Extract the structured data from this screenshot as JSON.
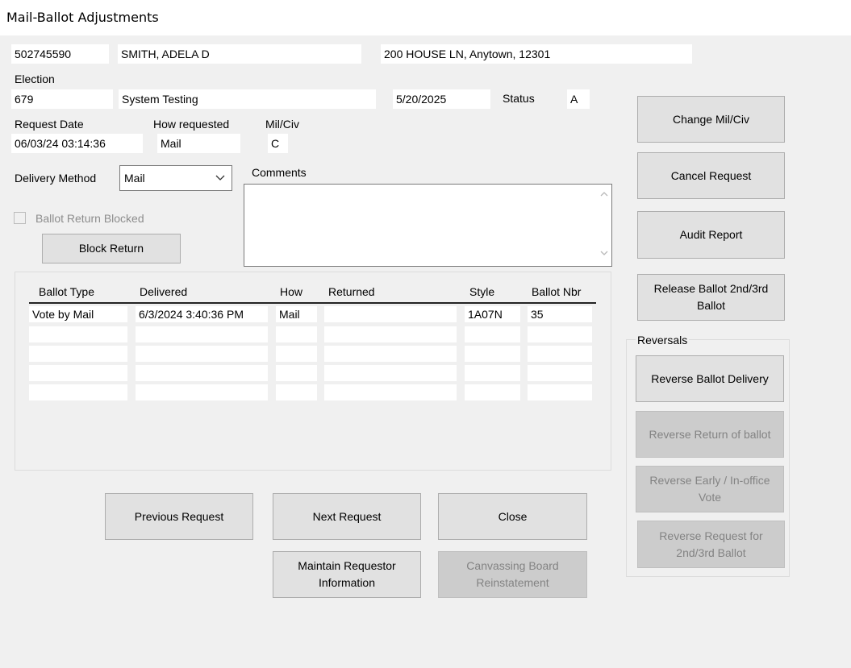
{
  "window": {
    "title": "Mail-Ballot Adjustments"
  },
  "voter": {
    "id": "502745590",
    "name": "SMITH, ADELA D",
    "address": "200 HOUSE LN, Anytown, 12301"
  },
  "election": {
    "label": "Election",
    "number": "679",
    "name": "System Testing",
    "date": "5/20/2025",
    "status_label": "Status",
    "status": "A"
  },
  "request": {
    "date_label": "Request Date",
    "date": "06/03/24 03:14:36",
    "how_label": "How requested",
    "how": "Mail",
    "milciv_label": "Mil/Civ",
    "milciv": "C"
  },
  "delivery": {
    "label": "Delivery Method",
    "selected": "Mail"
  },
  "comments": {
    "label": "Comments",
    "value": ""
  },
  "blocked": {
    "checkbox_label": "Ballot Return Blocked",
    "checked": false,
    "block_button": "Block Return"
  },
  "ballots": {
    "headers": [
      "Ballot Type",
      "Delivered",
      "How",
      "Returned",
      "Style",
      "Ballot Nbr"
    ],
    "rows": [
      [
        "Vote by Mail",
        "6/3/2024 3:40:36 PM",
        "Mail",
        "",
        "1A07N",
        "35"
      ],
      [
        "",
        "",
        "",
        "",
        "",
        ""
      ],
      [
        "",
        "",
        "",
        "",
        "",
        ""
      ],
      [
        "",
        "",
        "",
        "",
        "",
        ""
      ],
      [
        "",
        "",
        "",
        "",
        "",
        ""
      ]
    ]
  },
  "actions": {
    "change_milciv": "Change Mil/Civ",
    "cancel_request": "Cancel Request",
    "audit_report": "Audit Report",
    "release_ballot": "Release Ballot 2nd/3rd Ballot",
    "reversals_label": "Reversals",
    "reverse_delivery": "Reverse Ballot Delivery",
    "reverse_return": "Reverse Return of ballot",
    "reverse_early": "Reverse Early / In-office Vote",
    "reverse_request": "Reverse Request for 2nd/3rd Ballot"
  },
  "footer": {
    "previous": "Previous Request",
    "next": "Next Request",
    "close": "Close",
    "maintain": "Maintain Requestor Information",
    "canvassing": "Canvassing Board Reinstatement"
  }
}
